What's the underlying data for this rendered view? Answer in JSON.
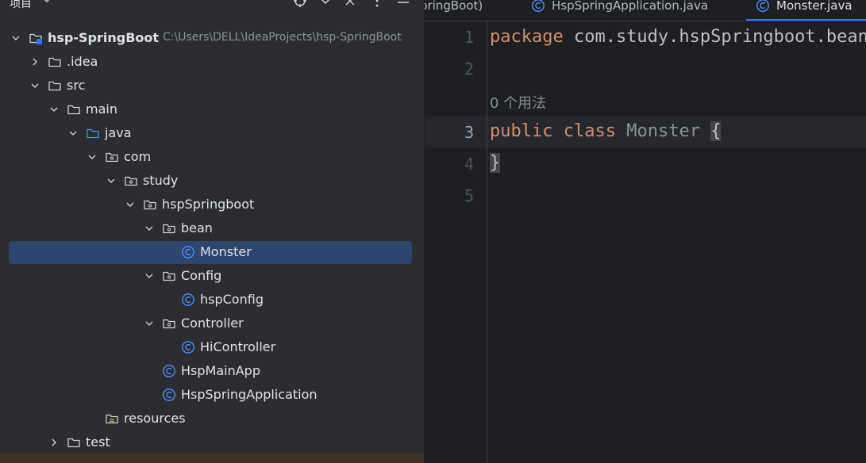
{
  "project_panel": {
    "title": "项目",
    "tree": [
      {
        "label": "hsp-SpringBoot",
        "path": "C:\\Users\\DELL\\IdeaProjects\\hsp-SpringBoot",
        "icon": "module-folder-icon",
        "arrow": "expanded"
      },
      {
        "label": ".idea",
        "icon": "folder-icon",
        "arrow": "collapsed"
      },
      {
        "label": "src",
        "icon": "folder-icon",
        "arrow": "expanded"
      },
      {
        "label": "main",
        "icon": "folder-icon",
        "arrow": "expanded"
      },
      {
        "label": "java",
        "icon": "source-folder-icon",
        "arrow": "expanded"
      },
      {
        "label": "com",
        "icon": "package-icon",
        "arrow": "expanded"
      },
      {
        "label": "study",
        "icon": "package-icon",
        "arrow": "expanded"
      },
      {
        "label": "hspSpringboot",
        "icon": "package-icon",
        "arrow": "expanded"
      },
      {
        "label": "bean",
        "icon": "package-icon",
        "arrow": "expanded"
      },
      {
        "label": "Monster",
        "icon": "class-icon",
        "selected": true
      },
      {
        "label": "Config",
        "icon": "package-icon",
        "arrow": "expanded"
      },
      {
        "label": "hspConfig",
        "icon": "class-icon"
      },
      {
        "label": "Controller",
        "icon": "package-icon",
        "arrow": "expanded"
      },
      {
        "label": "HiController",
        "icon": "class-icon"
      },
      {
        "label": "HspMainApp",
        "icon": "class-icon"
      },
      {
        "label": "HspSpringApplication",
        "icon": "class-icon"
      },
      {
        "label": "resources",
        "icon": "resources-folder-icon"
      },
      {
        "label": "test",
        "icon": "folder-icon",
        "arrow": "collapsed"
      }
    ]
  },
  "editor": {
    "tabs": [
      {
        "label": "pringBoot)",
        "active": false,
        "has_icon": false
      },
      {
        "label": "HspSpringApplication.java",
        "active": false,
        "has_icon": true
      },
      {
        "label": "Monster.java",
        "active": true,
        "has_icon": true
      }
    ],
    "line_numbers": [
      "1",
      "2",
      "3",
      "4",
      "5"
    ],
    "current_line": "3",
    "inlay_hint": "0 个用法",
    "code": {
      "line1_keyword": "package",
      "line1_rest": " com.study.hspSpringboot.bean;",
      "line3_kw1": "public",
      "line3_kw2": "class",
      "line3_name": "Monster",
      "line3_brace": "{",
      "line4_brace": "}"
    }
  },
  "colors": {
    "panel_bg": "#2b2d30",
    "editor_bg": "#1e1f22",
    "selection": "#2e436e",
    "keyword": "#cf8e6d",
    "class_icon": "#548af7",
    "accent": "#3574f0"
  }
}
